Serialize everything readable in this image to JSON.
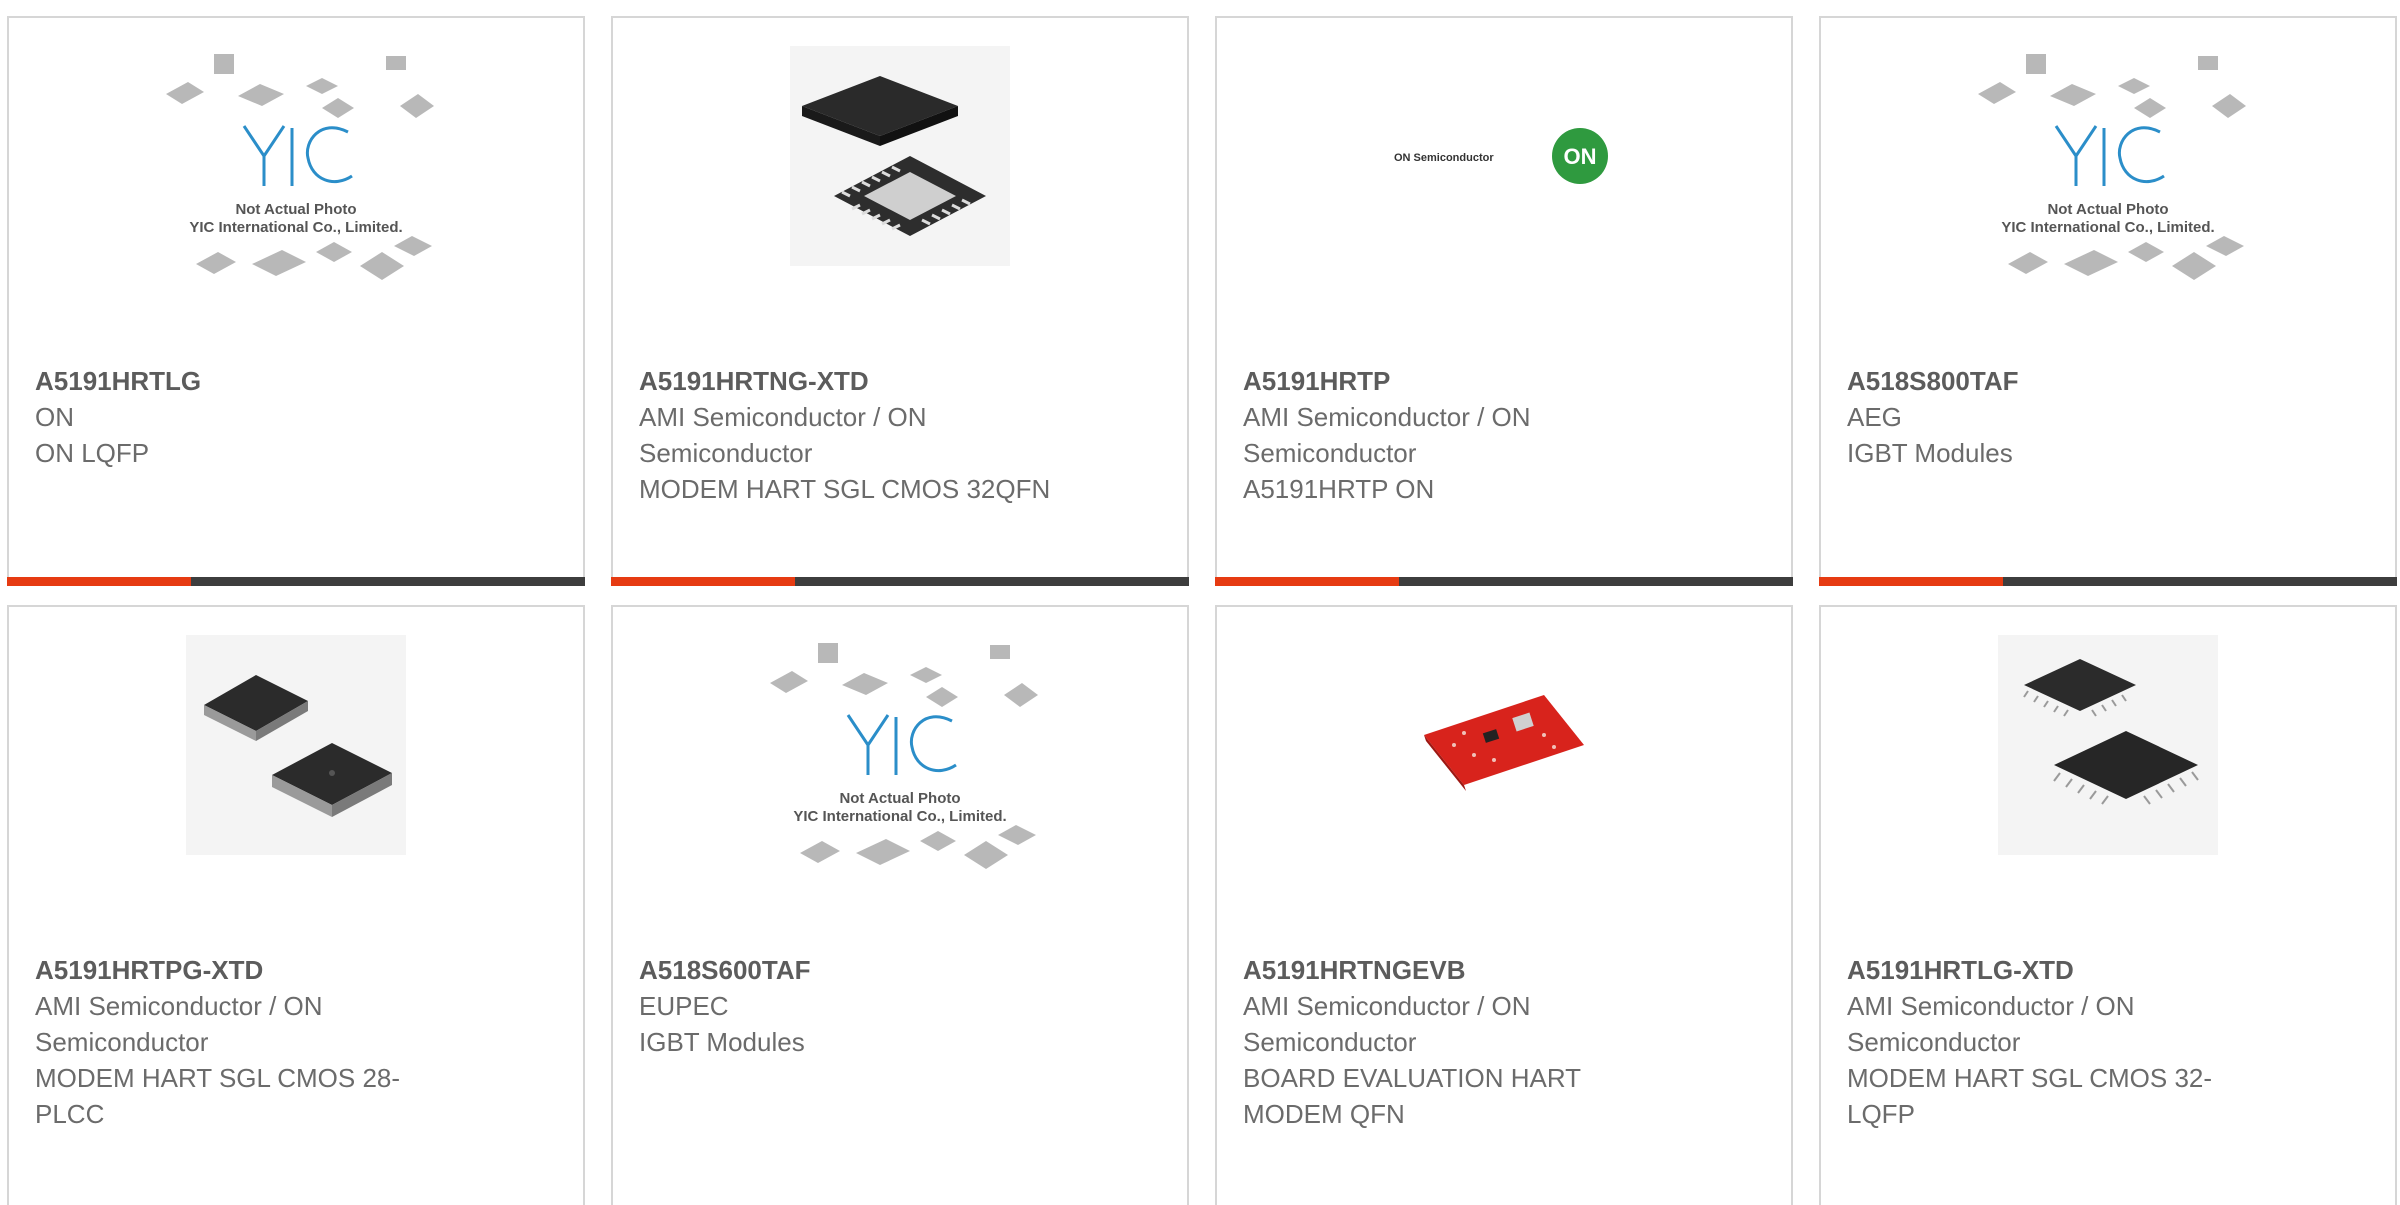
{
  "placeholder_caption": {
    "line1": "Not Actual Photo",
    "line2": "YIC International Co., Limited."
  },
  "logo_text": "ON Semiconductor",
  "logo_mark": "ON",
  "colors": {
    "accent": "#e63b12",
    "bar": "#3d3d3d",
    "border": "#d6d6d6"
  },
  "products": [
    {
      "part": "A5191HRTLG",
      "manufacturer": "ON",
      "description": "ON LQFP",
      "image": "yic-placeholder"
    },
    {
      "part": "A5191HRTNG-XTD",
      "manufacturer": "AMI Semiconductor / ON Semiconductor",
      "description": "MODEM HART SGL CMOS 32QFN",
      "image": "qfn-chip"
    },
    {
      "part": "A5191HRTP",
      "manufacturer": "AMI Semiconductor / ON Semiconductor",
      "description": "A5191HRTP ON",
      "image": "on-semiconductor-logo"
    },
    {
      "part": "A518S800TAF",
      "manufacturer": "AEG",
      "description": "IGBT Modules",
      "image": "yic-placeholder"
    },
    {
      "part": "A5191HRTPG-XTD",
      "manufacturer": "AMI Semiconductor / ON Semiconductor",
      "description": "MODEM HART SGL CMOS 28-PLCC",
      "image": "plcc-chips"
    },
    {
      "part": "A518S600TAF",
      "manufacturer": "EUPEC",
      "description": "IGBT Modules",
      "image": "yic-placeholder"
    },
    {
      "part": "A5191HRTNGEVB",
      "manufacturer": "AMI Semiconductor / ON Semiconductor",
      "description": "BOARD EVALUATION HART MODEM QFN",
      "image": "red-eval-board"
    },
    {
      "part": "A5191HRTLG-XTD",
      "manufacturer": "AMI Semiconductor / ON Semiconductor",
      "description": "MODEM HART SGL CMOS 32-LQFP",
      "image": "lqfp-chips"
    }
  ]
}
